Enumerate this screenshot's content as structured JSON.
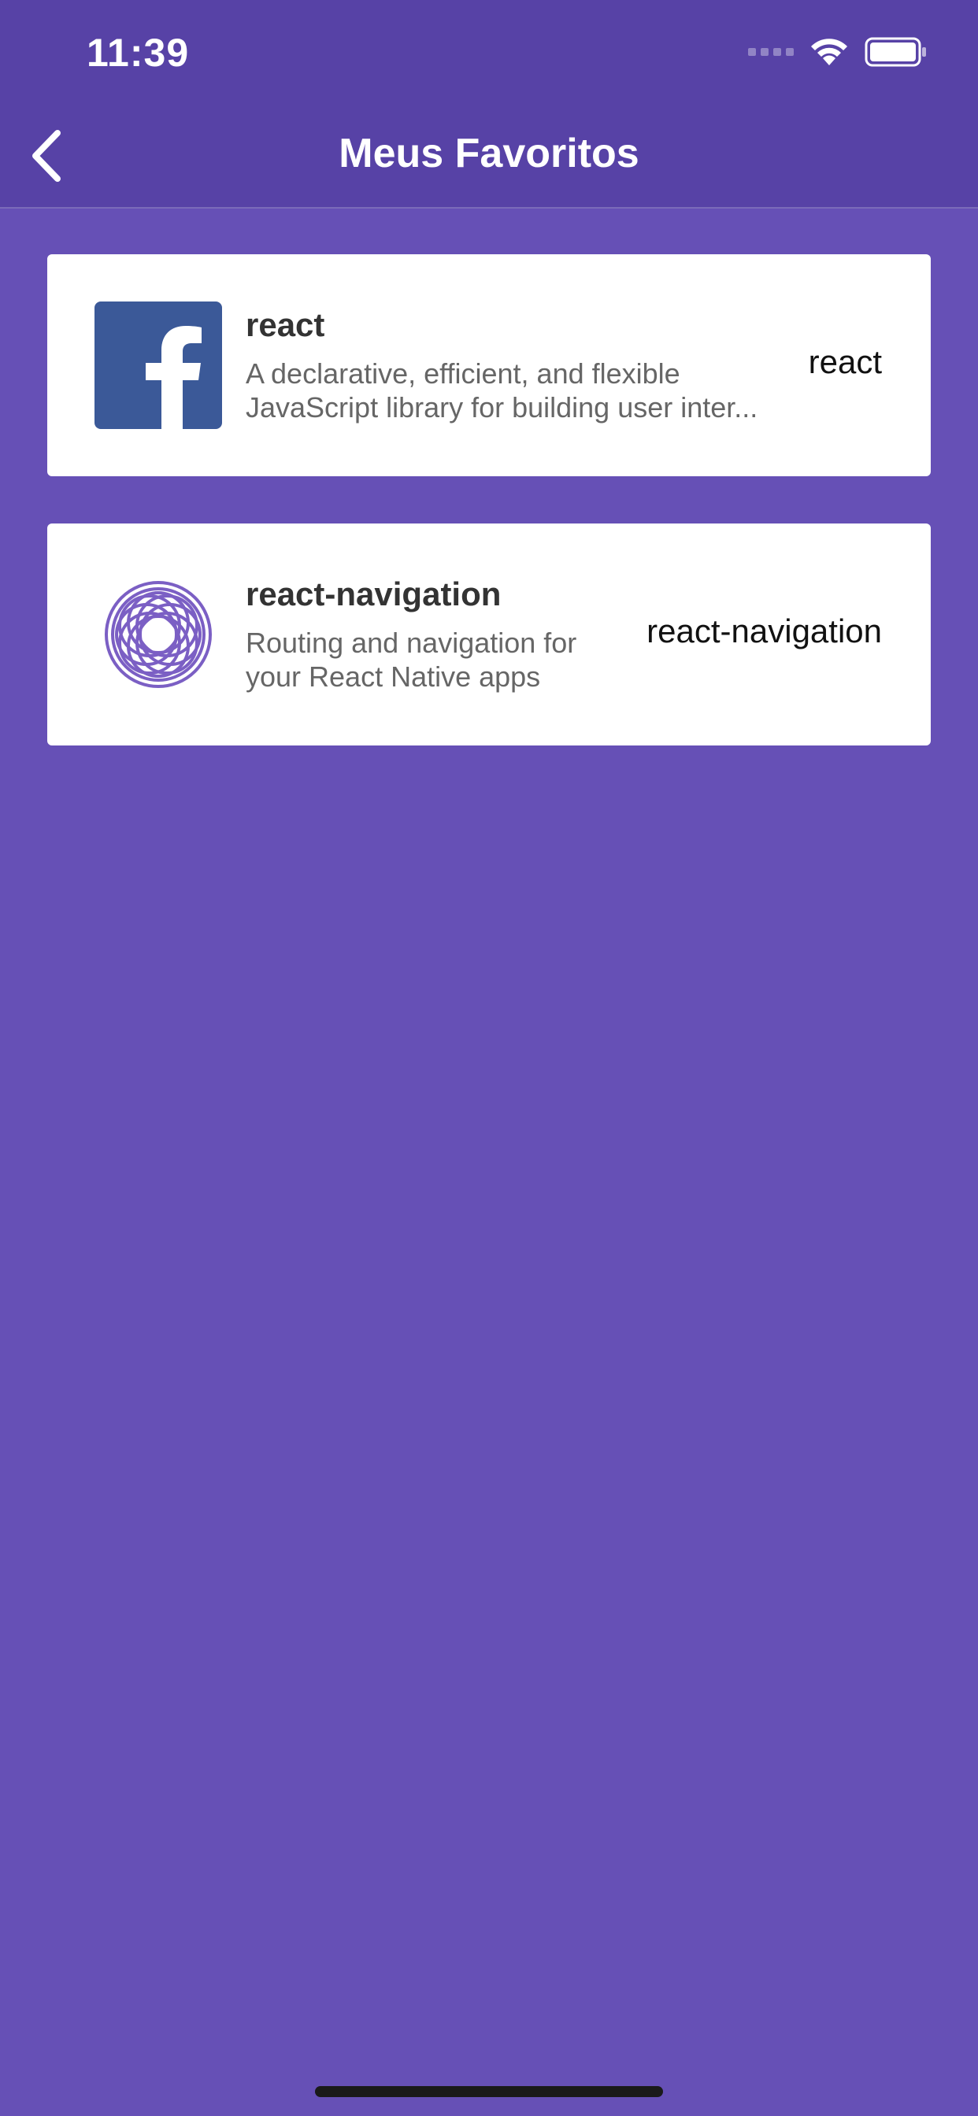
{
  "status_bar": {
    "time": "11:39",
    "icons": [
      "signal-icon",
      "wifi-icon",
      "battery-icon"
    ]
  },
  "header": {
    "back_icon": "chevron-left-icon",
    "title": "Meus Favoritos"
  },
  "favorites": [
    {
      "name": "react",
      "description_line1": "A declarative, efficient, and flexible",
      "description_line2": "JavaScript library for building user inter...",
      "side_label": "react",
      "logo_icon": "facebook-logo-icon"
    },
    {
      "name": "react-navigation",
      "description_line1": "Routing and navigation for",
      "description_line2": "your React Native apps",
      "side_label": "react-navigation",
      "logo_icon": "react-navigation-logo-icon"
    }
  ],
  "colors": {
    "background": "#6650b6",
    "header": "#5742a6",
    "card": "#ffffff",
    "facebook_blue": "#3b5998",
    "nav_logo_purple": "#7b5fc4"
  }
}
